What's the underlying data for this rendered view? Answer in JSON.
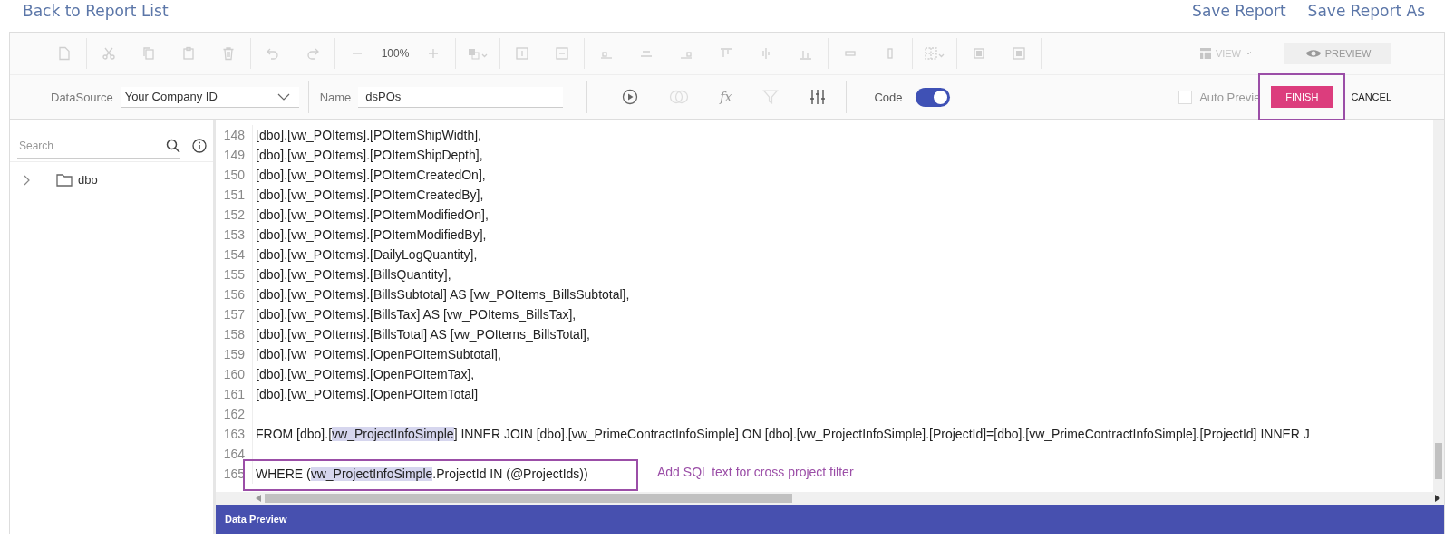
{
  "header": {
    "back_link": "Back to Report List",
    "actions": [
      "Save Report",
      "Save Report As"
    ]
  },
  "toolbar": {
    "disabled": true,
    "zoom": "100%",
    "view": "VIEW",
    "preview": "PREVIEW"
  },
  "query_bar": {
    "datasource_label": "DataSource",
    "datasource": "Your Company ID",
    "name_label": "Name",
    "name": "dsPOs",
    "formula": "fx",
    "code_label": "Code",
    "code_on": true,
    "auto_preview": {
      "label": "Auto Previe",
      "checked": false,
      "disabled": true
    },
    "finish": "FINISH",
    "finish_boxed": true,
    "cancel": "CANCEL"
  },
  "sidebar": {
    "search": {
      "placeholder": "Search"
    },
    "tree": [
      {
        "label": "dbo",
        "expanded": false
      }
    ]
  },
  "editor": {
    "lines": [
      {
        "number": "148",
        "boxed": false,
        "parts": [
          {
            "text": "[dbo].[vw_POItems].[POItemShipWidth],",
            "highlighted": false
          }
        ]
      },
      {
        "number": "149",
        "boxed": false,
        "parts": [
          {
            "text": "[dbo].[vw_POItems].[POItemShipDepth],",
            "highlighted": false
          }
        ]
      },
      {
        "number": "150",
        "boxed": false,
        "parts": [
          {
            "text": "[dbo].[vw_POItems].[POItemCreatedOn],",
            "highlighted": false
          }
        ]
      },
      {
        "number": "151",
        "boxed": false,
        "parts": [
          {
            "text": "[dbo].[vw_POItems].[POItemCreatedBy],",
            "highlighted": false
          }
        ]
      },
      {
        "number": "152",
        "boxed": false,
        "parts": [
          {
            "text": "[dbo].[vw_POItems].[POItemModifiedOn],",
            "highlighted": false
          }
        ]
      },
      {
        "number": "153",
        "boxed": false,
        "parts": [
          {
            "text": "[dbo].[vw_POItems].[POItemModifiedBy],",
            "highlighted": false
          }
        ]
      },
      {
        "number": "154",
        "boxed": false,
        "parts": [
          {
            "text": "[dbo].[vw_POItems].[DailyLogQuantity],",
            "highlighted": false
          }
        ]
      },
      {
        "number": "155",
        "boxed": false,
        "parts": [
          {
            "text": "[dbo].[vw_POItems].[BillsQuantity],",
            "highlighted": false
          }
        ]
      },
      {
        "number": "156",
        "boxed": false,
        "parts": [
          {
            "text": "[dbo].[vw_POItems].[BillsSubtotal] AS [vw_POItems_BillsSubtotal],",
            "highlighted": false
          }
        ]
      },
      {
        "number": "157",
        "boxed": false,
        "parts": [
          {
            "text": "[dbo].[vw_POItems].[BillsTax] AS [vw_POItems_BillsTax],",
            "highlighted": false
          }
        ]
      },
      {
        "number": "158",
        "boxed": false,
        "parts": [
          {
            "text": "[dbo].[vw_POItems].[BillsTotal] AS [vw_POItems_BillsTotal],",
            "highlighted": false
          }
        ]
      },
      {
        "number": "159",
        "boxed": false,
        "parts": [
          {
            "text": "[dbo].[vw_POItems].[OpenPOItemSubtotal],",
            "highlighted": false
          }
        ]
      },
      {
        "number": "160",
        "boxed": false,
        "parts": [
          {
            "text": "[dbo].[vw_POItems].[OpenPOItemTax],",
            "highlighted": false
          }
        ]
      },
      {
        "number": "161",
        "boxed": false,
        "parts": [
          {
            "text": "[dbo].[vw_POItems].[OpenPOItemTotal]",
            "highlighted": false
          }
        ]
      },
      {
        "number": "162",
        "boxed": false
      },
      {
        "number": "163",
        "boxed": false,
        "parts": [
          {
            "text": "FROM [dbo].[",
            "highlighted": false
          },
          {
            "text": "vw_ProjectInfoSimple",
            "highlighted": true
          },
          {
            "text": "] INNER JOIN [dbo].[vw_PrimeContractInfoSimple] ON [dbo].[vw_ProjectInfoSimple].[ProjectId]=[dbo].[vw_PrimeContractInfoSimple].[ProjectId] INNER J",
            "highlighted": false
          }
        ]
      },
      {
        "number": "164",
        "boxed": false
      },
      {
        "number": "165",
        "boxed": true,
        "parts": [
          {
            "text": "WHERE (",
            "highlighted": false
          },
          {
            "text": "vw_ProjectInfoSimple",
            "highlighted": true
          },
          {
            "text": ".ProjectId IN (@ProjectIds))",
            "highlighted": false
          }
        ]
      }
    ],
    "annotation": "Add SQL text for cross project filter"
  },
  "footer": {
    "title": "Data Preview"
  }
}
